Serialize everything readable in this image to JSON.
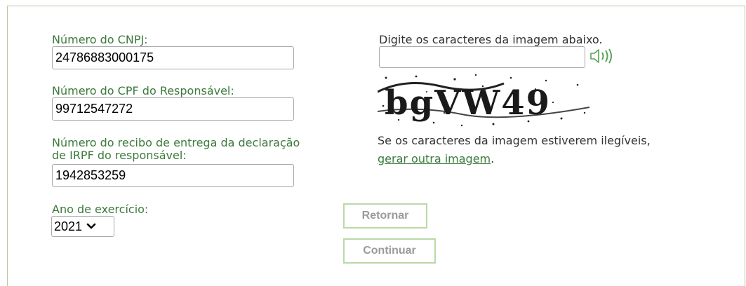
{
  "form": {
    "cnpj_label": "Número do CNPJ:",
    "cnpj_value": "24786883000175",
    "cpf_label": "Número do CPF do Responsável:",
    "cpf_value": "99712547272",
    "recibo_label_line1": "Número do recibo de entrega da declaração",
    "recibo_label_line2": "de IRPF do responsável:",
    "recibo_value": "1942853259",
    "ano_label": "Ano de exercício:",
    "ano_selected": "2021"
  },
  "captcha": {
    "instruction": "Digite os caracteres da imagem abaixo.",
    "input_value": "",
    "image_text": "bgVW49",
    "audio_icon": "speaker-icon",
    "help_text": "Se os caracteres da imagem estiverem ilegíveis,",
    "regenerate_link": "gerar outra imagem",
    "period": "."
  },
  "buttons": {
    "retornar": "Retornar",
    "continuar": "Continuar"
  },
  "colors": {
    "label_green": "#3c7a3c",
    "panel_border": "#b9c99b",
    "button_border": "#b9d9a6",
    "button_text": "#9a9a9a"
  }
}
